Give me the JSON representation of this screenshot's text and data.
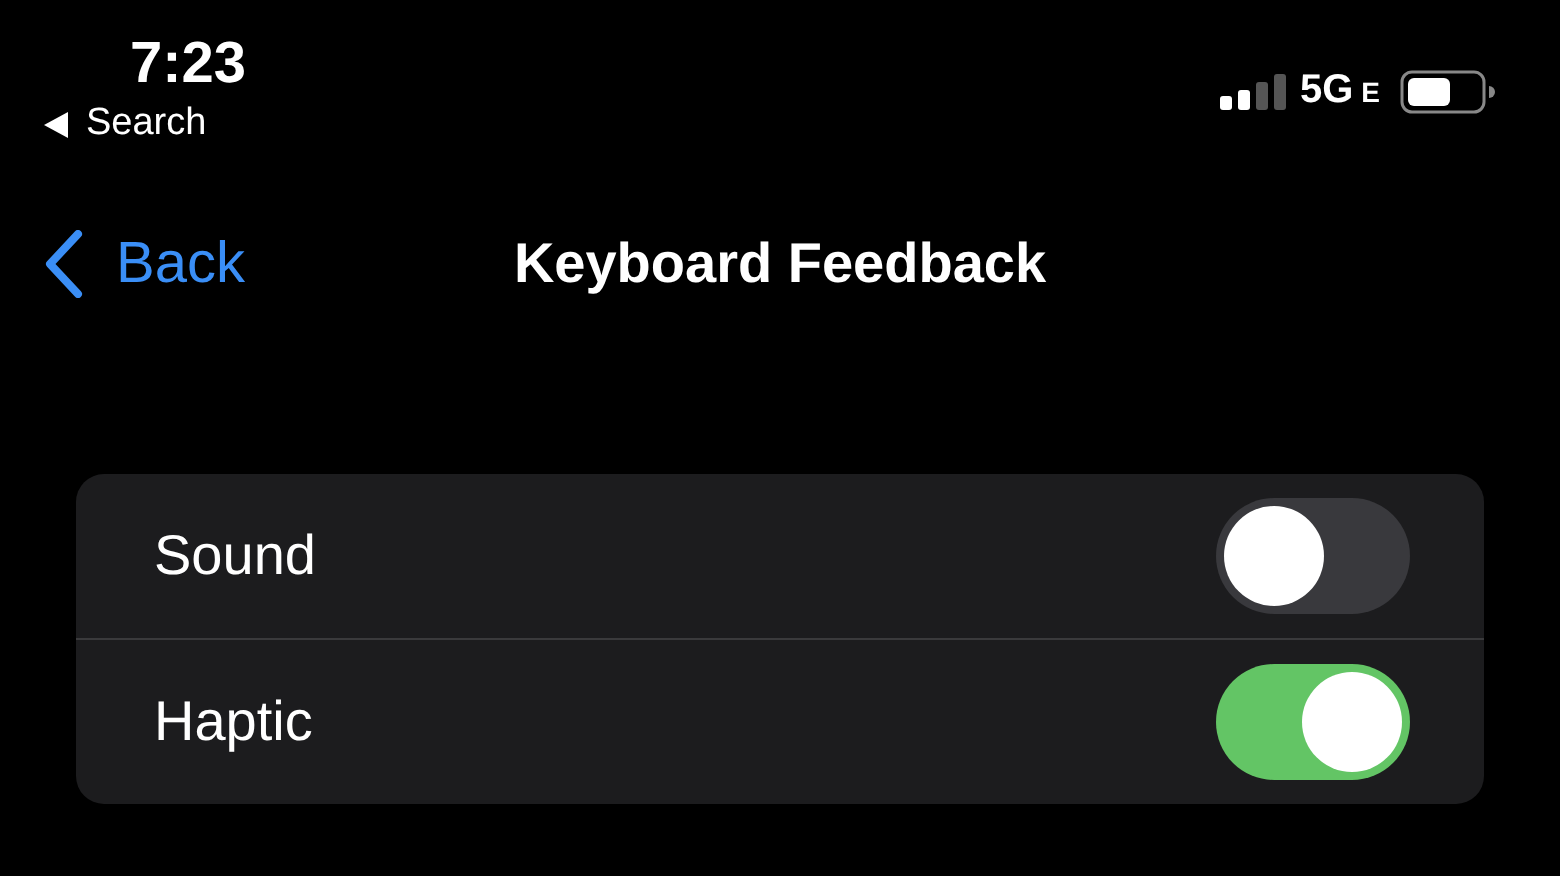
{
  "status_bar": {
    "time": "7:23",
    "back_app": "Search",
    "network": "5G",
    "network_sub": "E"
  },
  "nav": {
    "back": "Back",
    "title": "Keyboard Feedback"
  },
  "settings": [
    {
      "label": "Sound",
      "on": false
    },
    {
      "label": "Haptic",
      "on": true
    }
  ]
}
